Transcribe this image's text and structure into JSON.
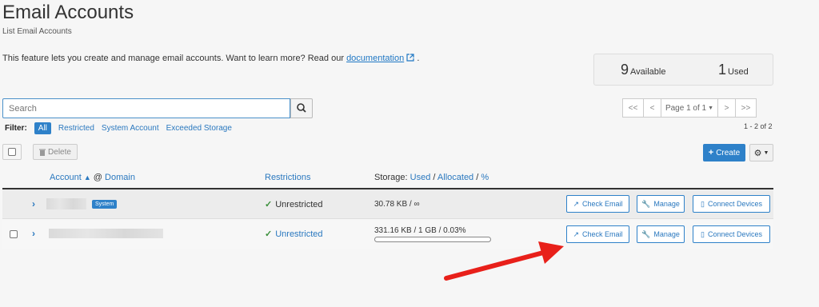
{
  "page": {
    "title": "Email Accounts",
    "subtitle": "List Email Accounts",
    "intro_text": "This feature lets you create and manage email accounts. Want to learn more? Read our",
    "intro_link": "documentation",
    "intro_end": "."
  },
  "stats": {
    "available_count": "9",
    "available_label": "Available",
    "used_count": "1",
    "used_label": "Used"
  },
  "search": {
    "placeholder": "Search",
    "value": "",
    "icon": "search-icon"
  },
  "pagination": {
    "first": "<<",
    "prev": "<",
    "page_label": "Page 1 of 1",
    "next": ">",
    "last": ">>",
    "count_text": "1 - 2 of 2"
  },
  "filter": {
    "label": "Filter:",
    "options": [
      "All",
      "Restricted",
      "System Account",
      "Exceeded Storage"
    ],
    "selected": "All"
  },
  "toolbar": {
    "delete_label": "Delete",
    "create_label": "Create",
    "settings_icon": "gear-icon"
  },
  "table": {
    "columns": {
      "account": "Account",
      "at": "@",
      "domain": "Domain",
      "restrictions": "Restrictions",
      "storage": "Storage:",
      "used": "Used",
      "sep1": "/",
      "allocated": "Allocated",
      "sep2": "/",
      "percent": "%"
    },
    "rows": [
      {
        "account": "",
        "badge": "System",
        "restriction": "Unrestricted",
        "storage": "30.78 KB / ∞",
        "actions": [
          "Check Email",
          "Manage",
          "Connect Devices"
        ]
      },
      {
        "account": "",
        "restriction": "Unrestricted",
        "storage": "331.16 KB / 1 GB / 0.03%",
        "usage_percent": 0.03,
        "actions": [
          "Check Email",
          "Manage",
          "Connect Devices"
        ]
      }
    ]
  },
  "colors": {
    "accent": "#2e81c9",
    "link": "#2a78bf",
    "success": "#3a8f3a",
    "annotation_arrow": "#e8201a"
  }
}
